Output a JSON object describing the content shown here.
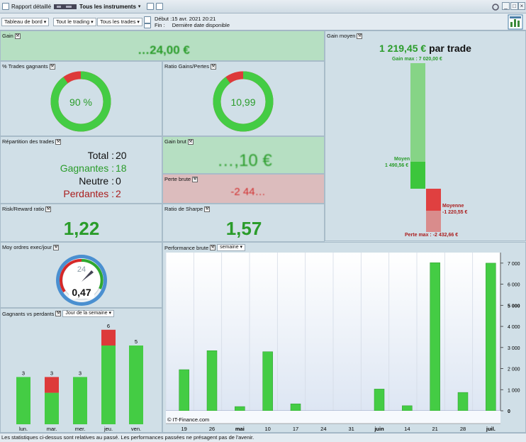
{
  "titlebar": {
    "report": "Rapport détaillé",
    "instruments": "Tous les instruments"
  },
  "toolbar": {
    "board": "Tableau de bord",
    "trading": "Tout le trading",
    "trades": "Tous les trades",
    "start_label": "Début :",
    "start_value": "15 avr. 2021 20:21",
    "end_label": "Fin :",
    "end_value": "Dernière date disponible"
  },
  "gain": {
    "title": "Gain",
    "value": "…24,00 €"
  },
  "pct_win": {
    "title": "% Trades gagnants",
    "value": "90 %",
    "fraction": 0.9
  },
  "ratio_gp": {
    "title": "Ratio Gains/Pertes",
    "value": "10,99",
    "fraction": 0.9
  },
  "gain_moyen": {
    "title": "Gain moyen",
    "value": "1 219,45 €",
    "suffix": "par trade",
    "gain_max": "Gain max : 7 020,00 €",
    "moyen_label": "Moyen",
    "moyen_value": "1 490,56 €",
    "moyenne_label": "Moyenne",
    "moyenne_value": "-1 220,55 €",
    "perte_max": "Perte max : -2 432,66 €"
  },
  "repartition": {
    "title": "Répartition des trades",
    "total_label": "Total :",
    "total": "20",
    "gagnantes_label": "Gagnantes :",
    "gagnantes": "18",
    "neutre_label": "Neutre :",
    "neutre": "0",
    "perdantes_label": "Perdantes :",
    "perdantes": "2"
  },
  "gain_brut": {
    "title": "Gain brut",
    "value": "…,10 €"
  },
  "perte_brute": {
    "title": "Perte brute",
    "value": "-2 44…"
  },
  "risk_reward": {
    "title": "Risk/Reward ratio",
    "value": "1,22"
  },
  "sharpe": {
    "title": "Ratio de Sharpe",
    "value": "1,57"
  },
  "ordres": {
    "title": "Moy ordres exec/jour",
    "value": "0,47",
    "clock": "24"
  },
  "gp": {
    "title": "Gagnants vs perdants",
    "dropdown": "Jour de la semaine"
  },
  "perf": {
    "title": "Performance brute",
    "dropdown": "semaine",
    "watermark": "© IT-Finance.com"
  },
  "status": "Les statistiques ci-dessus sont relatives au passé. Les performances passées ne présagent pas de l'avenir.",
  "colors": {
    "green": "#44cc44",
    "red": "#dd3a3a",
    "panel": "#d0dfe7"
  },
  "chart_data": [
    {
      "type": "bar",
      "title": "Gagnants vs perdants",
      "categories": [
        "lun.",
        "mar.",
        "mer.",
        "jeu.",
        "ven."
      ],
      "series": [
        {
          "values": [
            3,
            2,
            3,
            5,
            5
          ],
          "color": "#44cc44"
        },
        {
          "values": [
            0,
            1,
            0,
            1,
            0
          ],
          "color": "#dd3a3a"
        }
      ],
      "totals": [
        "3",
        "3",
        "3",
        "6",
        "5"
      ],
      "stacked": true
    },
    {
      "type": "bar",
      "title": "Performance brute",
      "x": [
        "19",
        "26",
        "mai",
        "10",
        "17",
        "24",
        "31",
        "juin",
        "14",
        "21",
        "28",
        "juil."
      ],
      "values": [
        1950,
        2850,
        200,
        2800,
        330,
        0,
        0,
        1030,
        240,
        7020,
        870,
        7000
      ],
      "ylim": [
        0,
        7500
      ],
      "yticks": [
        "0",
        "1 000",
        "2 000",
        "3 000",
        "4 000",
        "5 000",
        "6 000",
        "7 000"
      ],
      "bold_x": [
        "mai",
        "juin",
        "juil."
      ],
      "bold_y": [
        "0",
        "5 000"
      ]
    }
  ]
}
